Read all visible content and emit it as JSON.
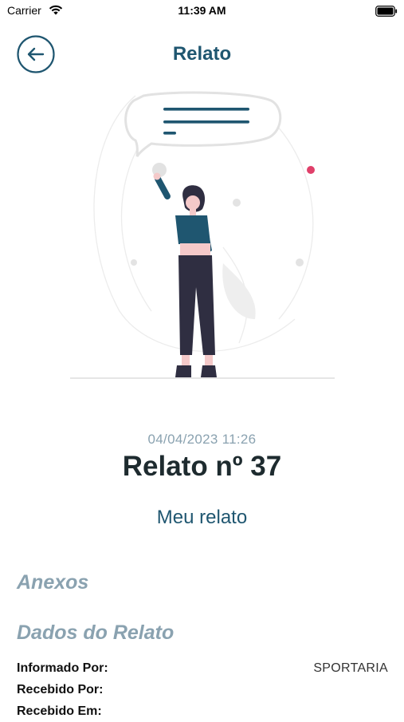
{
  "status_bar": {
    "carrier": "Carrier",
    "time": "11:39 AM"
  },
  "header": {
    "title": "Relato",
    "back_icon": "arrow-left-icon"
  },
  "illustration": {
    "name": "woman-raising-hand-with-speech-bubble",
    "accent_color": "#1f5670",
    "dot_color": "#e0406a"
  },
  "report": {
    "date": "04/04/2023 11:26",
    "number": "Relato nº 37",
    "my_report_link": "Meu relato"
  },
  "sections": {
    "attachments": "Anexos",
    "report_data": "Dados do Relato"
  },
  "details": [
    {
      "label": "Informado Por:",
      "value": "SPORTARIA"
    },
    {
      "label": "Recebido Por:",
      "value": ""
    },
    {
      "label": "Recebido Em:",
      "value": ""
    }
  ],
  "colors": {
    "primary": "#1f5670",
    "muted": "#8aa2b0",
    "text_dark": "#1e2b2f"
  }
}
